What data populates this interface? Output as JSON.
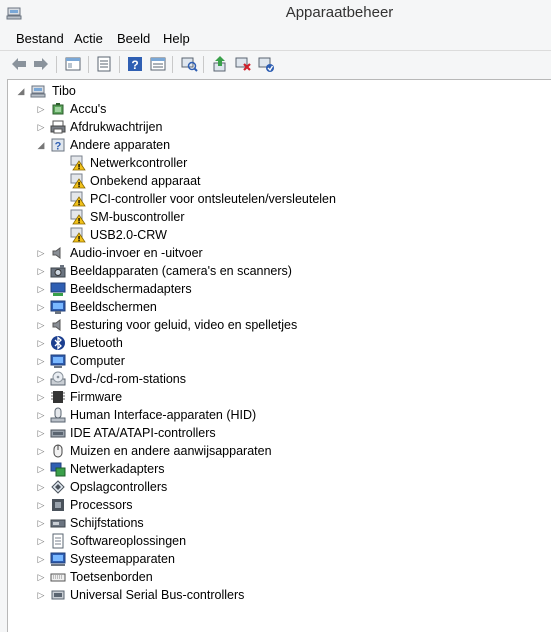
{
  "window": {
    "title": "Apparaatbeheer"
  },
  "menu": [
    "Bestand",
    "Actie",
    "Beeld",
    "Help"
  ],
  "toolbar": [
    {
      "name": "back-icon"
    },
    {
      "name": "forward-icon"
    },
    {
      "name": "properties-view-icon"
    },
    {
      "name": "list-icon"
    },
    {
      "name": "help-icon"
    },
    {
      "name": "window-view-icon"
    },
    {
      "name": "scan-hardware-icon"
    },
    {
      "name": "update-driver-icon"
    },
    {
      "name": "uninstall-icon"
    },
    {
      "name": "enable-device-icon"
    }
  ],
  "tree": {
    "root": "Tibo",
    "nodes": [
      {
        "label": "Accu's",
        "icon": "battery-icon",
        "expander": "collapsed",
        "level": 1
      },
      {
        "label": "Afdrukwachtrijen",
        "icon": "printer-icon",
        "expander": "collapsed",
        "level": 1
      },
      {
        "label": "Andere apparaten",
        "icon": "unknown-device-icon",
        "expander": "expanded",
        "level": 1
      },
      {
        "label": "Netwerkcontroller",
        "icon": "warning-device-icon",
        "expander": "none",
        "level": 2
      },
      {
        "label": "Onbekend apparaat",
        "icon": "warning-device-icon",
        "expander": "none",
        "level": 2
      },
      {
        "label": "PCI-controller voor ontsleutelen/versleutelen",
        "icon": "warning-device-icon",
        "expander": "none",
        "level": 2
      },
      {
        "label": "SM-buscontroller",
        "icon": "warning-device-icon",
        "expander": "none",
        "level": 2
      },
      {
        "label": "USB2.0-CRW",
        "icon": "warning-device-icon",
        "expander": "none",
        "level": 2
      },
      {
        "label": "Audio-invoer en -uitvoer",
        "icon": "speaker-icon",
        "expander": "collapsed",
        "level": 1
      },
      {
        "label": "Beeldapparaten (camera's en scanners)",
        "icon": "camera-icon",
        "expander": "collapsed",
        "level": 1
      },
      {
        "label": "Beeldschermadapters",
        "icon": "display-adapter-icon",
        "expander": "collapsed",
        "level": 1
      },
      {
        "label": "Beeldschermen",
        "icon": "monitor-icon",
        "expander": "collapsed",
        "level": 1
      },
      {
        "label": "Besturing voor geluid, video en spelletjes",
        "icon": "speaker-icon",
        "expander": "collapsed",
        "level": 1
      },
      {
        "label": "Bluetooth",
        "icon": "bluetooth-icon",
        "expander": "collapsed",
        "level": 1
      },
      {
        "label": "Computer",
        "icon": "computer-icon",
        "expander": "collapsed",
        "level": 1
      },
      {
        "label": "Dvd-/cd-rom-stations",
        "icon": "dvd-drive-icon",
        "expander": "collapsed",
        "level": 1
      },
      {
        "label": "Firmware",
        "icon": "firmware-icon",
        "expander": "collapsed",
        "level": 1
      },
      {
        "label": "Human Interface-apparaten (HID)",
        "icon": "hid-icon",
        "expander": "collapsed",
        "level": 1
      },
      {
        "label": "IDE ATA/ATAPI-controllers",
        "icon": "ide-controller-icon",
        "expander": "collapsed",
        "level": 1
      },
      {
        "label": "Muizen en andere aanwijsapparaten",
        "icon": "mouse-icon",
        "expander": "collapsed",
        "level": 1
      },
      {
        "label": "Netwerkadapters",
        "icon": "network-adapter-icon",
        "expander": "collapsed",
        "level": 1
      },
      {
        "label": "Opslagcontrollers",
        "icon": "storage-controller-icon",
        "expander": "collapsed",
        "level": 1
      },
      {
        "label": "Processors",
        "icon": "processor-icon",
        "expander": "collapsed",
        "level": 1
      },
      {
        "label": "Schijfstations",
        "icon": "disk-drive-icon",
        "expander": "collapsed",
        "level": 1
      },
      {
        "label": "Softwareoplossingen",
        "icon": "software-icon",
        "expander": "collapsed",
        "level": 1
      },
      {
        "label": "Systeemapparaten",
        "icon": "system-device-icon",
        "expander": "collapsed",
        "level": 1
      },
      {
        "label": "Toetsenborden",
        "icon": "keyboard-icon",
        "expander": "collapsed",
        "level": 1
      },
      {
        "label": "Universal Serial Bus-controllers",
        "icon": "usb-icon",
        "expander": "collapsed",
        "level": 1
      }
    ]
  }
}
